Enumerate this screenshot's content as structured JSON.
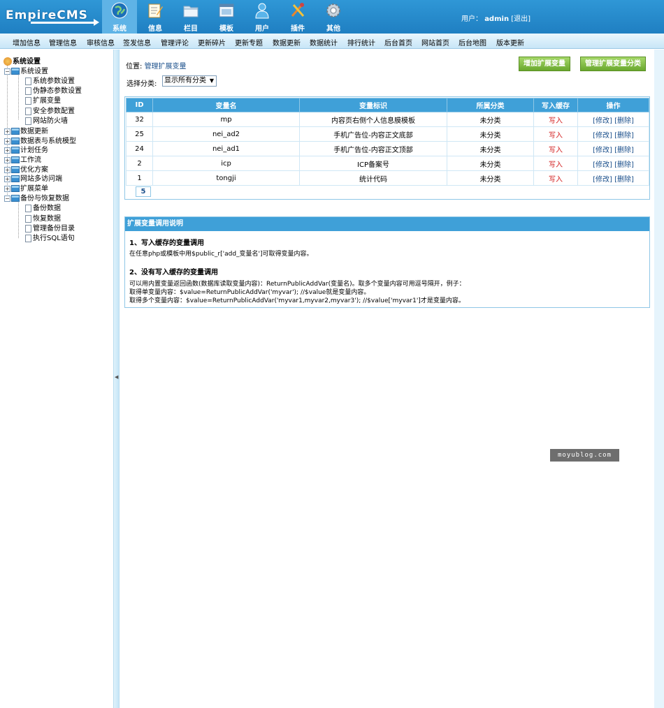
{
  "header": {
    "logo": "EmpireCMS",
    "nav": [
      {
        "label": "系统",
        "icon": "globe-icon",
        "active": true
      },
      {
        "label": "信息",
        "icon": "document-edit-icon"
      },
      {
        "label": "栏目",
        "icon": "folder-icon"
      },
      {
        "label": "模板",
        "icon": "window-template-icon"
      },
      {
        "label": "用户",
        "icon": "user-icon"
      },
      {
        "label": "插件",
        "icon": "tools-icon"
      },
      {
        "label": "其他",
        "icon": "gear-icon"
      }
    ],
    "user_label": "用户：",
    "username": "admin",
    "logout": "[退出]"
  },
  "submenu": [
    "增加信息",
    "管理信息",
    "审核信息",
    "签发信息",
    "管理评论",
    "更新碎片",
    "更新专题",
    "数据更新",
    "数据统计",
    "排行统计",
    "后台首页",
    "网站首页",
    "后台地图",
    "版本更新"
  ],
  "sidebar": {
    "root": "系统设置",
    "groups": [
      {
        "label": "系统设置",
        "expanded": true,
        "children": [
          "系统参数设置",
          "伪静态参数设置",
          "扩展变量",
          "安全参数配置",
          "网站防火墙"
        ]
      },
      {
        "label": "数据更新",
        "expanded": false
      },
      {
        "label": "数据表与系统模型",
        "expanded": false
      },
      {
        "label": "计划任务",
        "expanded": false
      },
      {
        "label": "工作流",
        "expanded": false
      },
      {
        "label": "优化方案",
        "expanded": false
      },
      {
        "label": "网站多访问端",
        "expanded": false
      },
      {
        "label": "扩展菜单",
        "expanded": false
      },
      {
        "label": "备份与恢复数据",
        "expanded": true,
        "children": [
          "备份数据",
          "恢复数据",
          "管理备份目录",
          "执行SQL语句"
        ]
      }
    ]
  },
  "main": {
    "breadcrumb_prefix": "位置:",
    "breadcrumb_link": "管理扩展变量",
    "buttons": {
      "add": "增加扩展变量",
      "manage_class": "管理扩展变量分类"
    },
    "filter_label": "选择分类:",
    "filter_value": "显示所有分类",
    "table": {
      "headers": [
        "ID",
        "变量名",
        "变量标识",
        "所属分类",
        "写入缓存",
        "操作"
      ],
      "rows": [
        {
          "id": "32",
          "name": "mp",
          "label": "内容页右侧个人信息膜模板",
          "category": "未分类",
          "cache": "写入",
          "edit": "[修改]",
          "delete": "[删除]"
        },
        {
          "id": "25",
          "name": "nei_ad2",
          "label": "手机广告位-内容正文底部",
          "category": "未分类",
          "cache": "写入",
          "edit": "[修改]",
          "delete": "[删除]"
        },
        {
          "id": "24",
          "name": "nei_ad1",
          "label": "手机广告位-内容正文顶部",
          "category": "未分类",
          "cache": "写入",
          "edit": "[修改]",
          "delete": "[删除]"
        },
        {
          "id": "2",
          "name": "icp",
          "label": "ICP备案号",
          "category": "未分类",
          "cache": "写入",
          "edit": "[修改]",
          "delete": "[删除]"
        },
        {
          "id": "1",
          "name": "tongji",
          "label": "统计代码",
          "category": "未分类",
          "cache": "写入",
          "edit": "[修改]",
          "delete": "[删除]"
        }
      ],
      "page": "5"
    },
    "help": {
      "title": "扩展变量调用说明",
      "h1": "1、写入缓存的变量调用",
      "p1": "在任意php或模板中用$public_r['add_变量名']可取得变量内容。",
      "h2": "2、没有写入缓存的变量调用",
      "p2": "可以用内置变量返回函数(数据库读取变量内容)：ReturnPublicAddVar(变量名)。取多个变量内容可用逗号隔开，例子：",
      "p3": "取得单变量内容：$value=ReturnPublicAddVar('myvar'); //$value就是变量内容。",
      "p4": "取得多个变量内容：$value=ReturnPublicAddVar('myvar1,myvar2,myvar3'); //$value['myvar1']才是变量内容。"
    }
  },
  "watermark": "moyublog.com"
}
